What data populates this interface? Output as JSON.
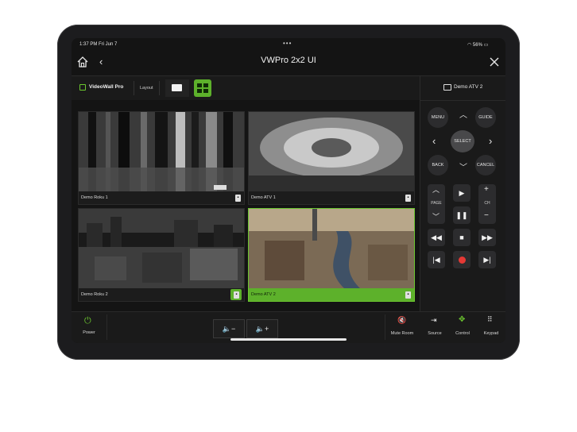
{
  "status": {
    "time": "1:37 PM  Fri Jun 7",
    "battery": "56%"
  },
  "header": {
    "title": "VWPro 2x2 UI"
  },
  "toolbar": {
    "brand": "VideoWall Pro",
    "layout_label": "Layout"
  },
  "device_panel": {
    "title": "Demo ATV 2"
  },
  "tiles": [
    {
      "label": "Demo Roku 1",
      "selected": false
    },
    {
      "label": "Demo ATV 1",
      "selected": false
    },
    {
      "label": "Demo Roku 2",
      "selected": false
    },
    {
      "label": "Demo ATV 2",
      "selected": true
    }
  ],
  "remote": {
    "menu": "MENU",
    "guide": "GUIDE",
    "select": "SELECT",
    "back": "BACK",
    "cancel": "CANCEL",
    "page": "PAGE",
    "ch": "CH"
  },
  "bottom": {
    "power": "Power",
    "mute_room": "Mute Room",
    "source": "Source",
    "control": "Control",
    "keypad": "Keypad"
  },
  "colors": {
    "accent": "#6cc72f",
    "record": "#e53935"
  }
}
